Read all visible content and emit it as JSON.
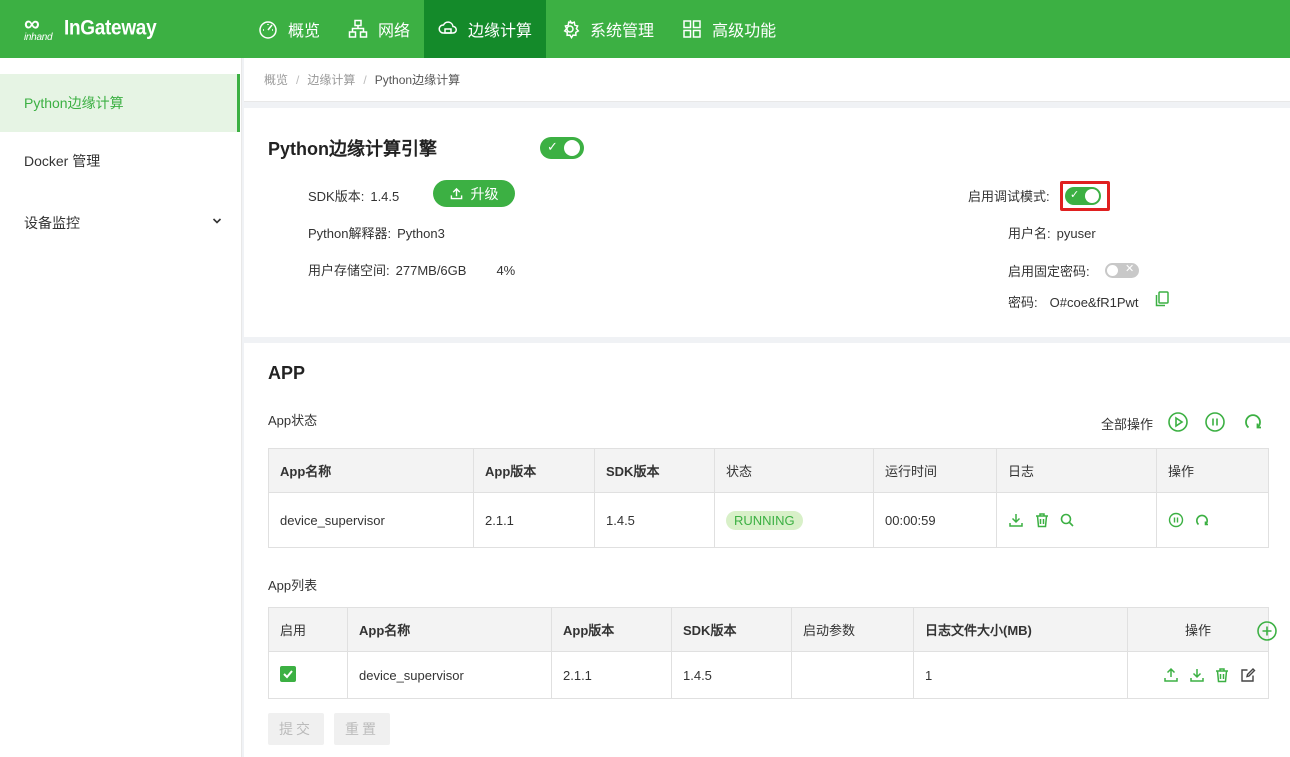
{
  "brand": {
    "logo_mark_top": "∞",
    "logo_mark_bottom": "inhand",
    "name": "InGateway"
  },
  "nav": [
    {
      "label": "概览",
      "icon": "dashboard-icon"
    },
    {
      "label": "网络",
      "icon": "network-icon"
    },
    {
      "label": "边缘计算",
      "icon": "cloud-compute-icon",
      "active": true
    },
    {
      "label": "系统管理",
      "icon": "gear-icon"
    },
    {
      "label": "高级功能",
      "icon": "grid-icon"
    }
  ],
  "sidebar": {
    "items": [
      {
        "label": "Python边缘计算",
        "active": true
      },
      {
        "label": "Docker 管理"
      },
      {
        "label": "设备监控",
        "expandable": true
      }
    ]
  },
  "breadcrumb": [
    "概览",
    "边缘计算",
    "Python边缘计算"
  ],
  "engine": {
    "title": "Python边缘计算引擎",
    "enabled": true,
    "sdk_label": "SDK版本:",
    "sdk_value": "1.4.5",
    "upgrade_label": "升级",
    "interpreter_label": "Python解释器:",
    "interpreter_value": "Python3",
    "storage_label": "用户存储空间:",
    "storage_value": "277MB/6GB",
    "storage_percent": "4%",
    "debug_label": "启用调试模式:",
    "debug_enabled": true,
    "username_label": "用户名:",
    "username_value": "pyuser",
    "fixed_pwd_label": "启用固定密码:",
    "fixed_pwd_enabled": false,
    "password_label": "密码:",
    "password_value": "O#coe&fR1Pwt"
  },
  "app": {
    "title": "APP",
    "status_title": "App状态",
    "all_ops_label": "全部操作",
    "status_table": {
      "headers": [
        "App名称",
        "App版本",
        "SDK版本",
        "状态",
        "运行时间",
        "日志",
        "操作"
      ],
      "rows": [
        {
          "name": "device_supervisor",
          "app_version": "2.1.1",
          "sdk_version": "1.4.5",
          "status": "RUNNING",
          "runtime": "00:00:59"
        }
      ]
    },
    "list_title": "App列表",
    "list_table": {
      "headers": [
        "启用",
        "App名称",
        "App版本",
        "SDK版本",
        "启动参数",
        "日志文件大小(MB)",
        "操作"
      ],
      "rows": [
        {
          "enabled": true,
          "name": "device_supervisor",
          "app_version": "2.1.1",
          "sdk_version": "1.4.5",
          "start_args": "",
          "log_size": "1"
        }
      ]
    },
    "submit_label": "提交",
    "reset_label": "重置"
  },
  "colors": {
    "primary": "#3cb043",
    "nav_active": "#148a2a",
    "highlight_border": "#e02020"
  }
}
